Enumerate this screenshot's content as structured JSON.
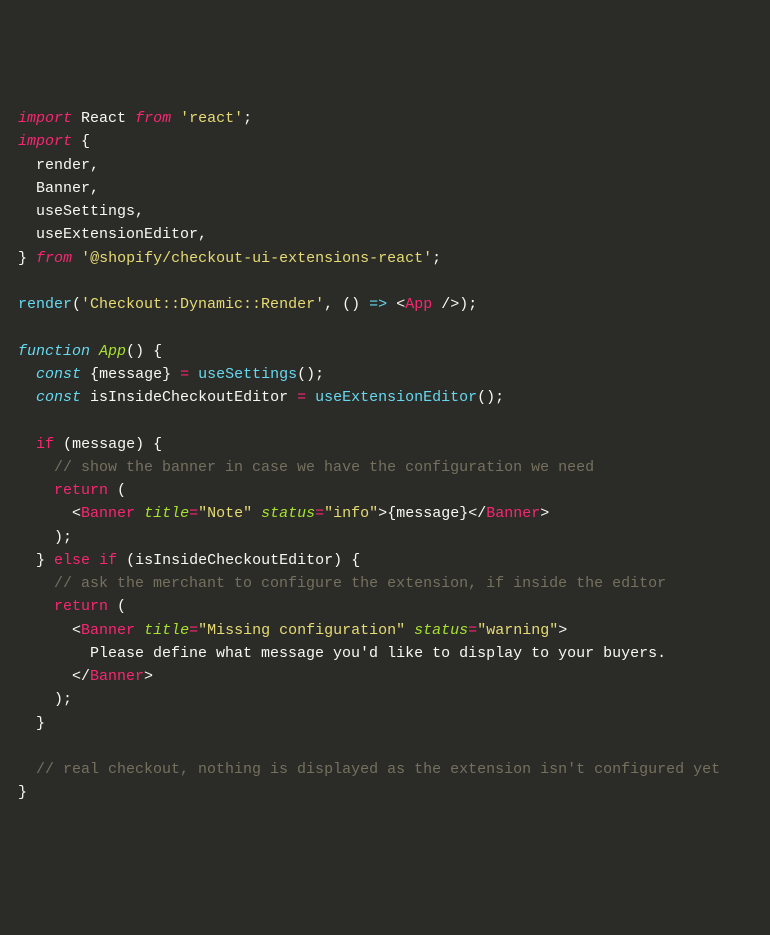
{
  "code": {
    "l1": {
      "import": "import",
      "react": "React",
      "from": "from",
      "reactPkg": "'react'"
    },
    "l2": {
      "import": "import",
      "brace": "{"
    },
    "l3": {
      "render": "render,"
    },
    "l4": {
      "banner": "Banner,"
    },
    "l5": {
      "useSettings": "useSettings,"
    },
    "l6": {
      "useExtensionEditor": "useExtensionEditor,"
    },
    "l7": {
      "brace": "}",
      "from": "from",
      "pkg": "'@shopify/checkout-ui-extensions-react'"
    },
    "l9": {
      "render": "render",
      "lp": "(",
      "entry": "'Checkout::Dynamic::Render'",
      "comma": ",",
      "sp": " ",
      "lp2": "(",
      "rp2": ")",
      "arrow": "=>",
      "lt": "<",
      "app": "App",
      "slash": "/>",
      "rp": ")",
      "sc": ";"
    },
    "l11": {
      "function": "function",
      "app": "App",
      "lp": "(",
      "rp": ")",
      "brace": "{"
    },
    "l12": {
      "const": "const",
      "lb": "{",
      "message": "message",
      "rb": "}",
      "eq": "=",
      "useSettings": "useSettings",
      "call": "();"
    },
    "l13": {
      "const": "const",
      "var": "isInsideCheckoutEditor",
      "eq": "=",
      "useExtensionEditor": "useExtensionEditor",
      "call": "();"
    },
    "l15": {
      "if": "if",
      "lp": "(",
      "message": "message",
      "rp": ")",
      "brace": "{"
    },
    "l16": {
      "cmt": "// show the banner in case we have the configuration we need"
    },
    "l17": {
      "return": "return",
      "lp": "("
    },
    "l18": {
      "lt": "<",
      "banner": "Banner",
      "title": "title",
      "eq1": "=",
      "titleVal": "\"Note\"",
      "status": "status",
      "eq2": "=",
      "statusVal": "\"info\"",
      "gt": ">",
      "lb": "{",
      "message": "message",
      "rb": "}",
      "lt2": "</",
      "banner2": "Banner",
      "gt2": ">"
    },
    "l19": {
      "rp": ");"
    },
    "l20": {
      "brace": "}",
      "else": "else",
      "if": "if",
      "lp": "(",
      "var": "isInsideCheckoutEditor",
      "rp": ")",
      "brace2": "{"
    },
    "l21": {
      "cmt": "// ask the merchant to configure the extension, if inside the editor"
    },
    "l22": {
      "return": "return",
      "lp": "("
    },
    "l23": {
      "lt": "<",
      "banner": "Banner",
      "title": "title",
      "eq1": "=",
      "titleVal": "\"Missing configuration\"",
      "status": "status",
      "eq2": "=",
      "statusVal": "\"warning\"",
      "gt": ">"
    },
    "l24": {
      "text": "Please define what message you'd like to display to your buyers."
    },
    "l25": {
      "lt": "</",
      "banner": "Banner",
      "gt": ">"
    },
    "l26": {
      "rp": ");"
    },
    "l27": {
      "brace": "}"
    },
    "l29": {
      "cmt": "// real checkout, nothing is displayed as the extension isn't configured yet"
    },
    "l30": {
      "brace": "}"
    }
  }
}
